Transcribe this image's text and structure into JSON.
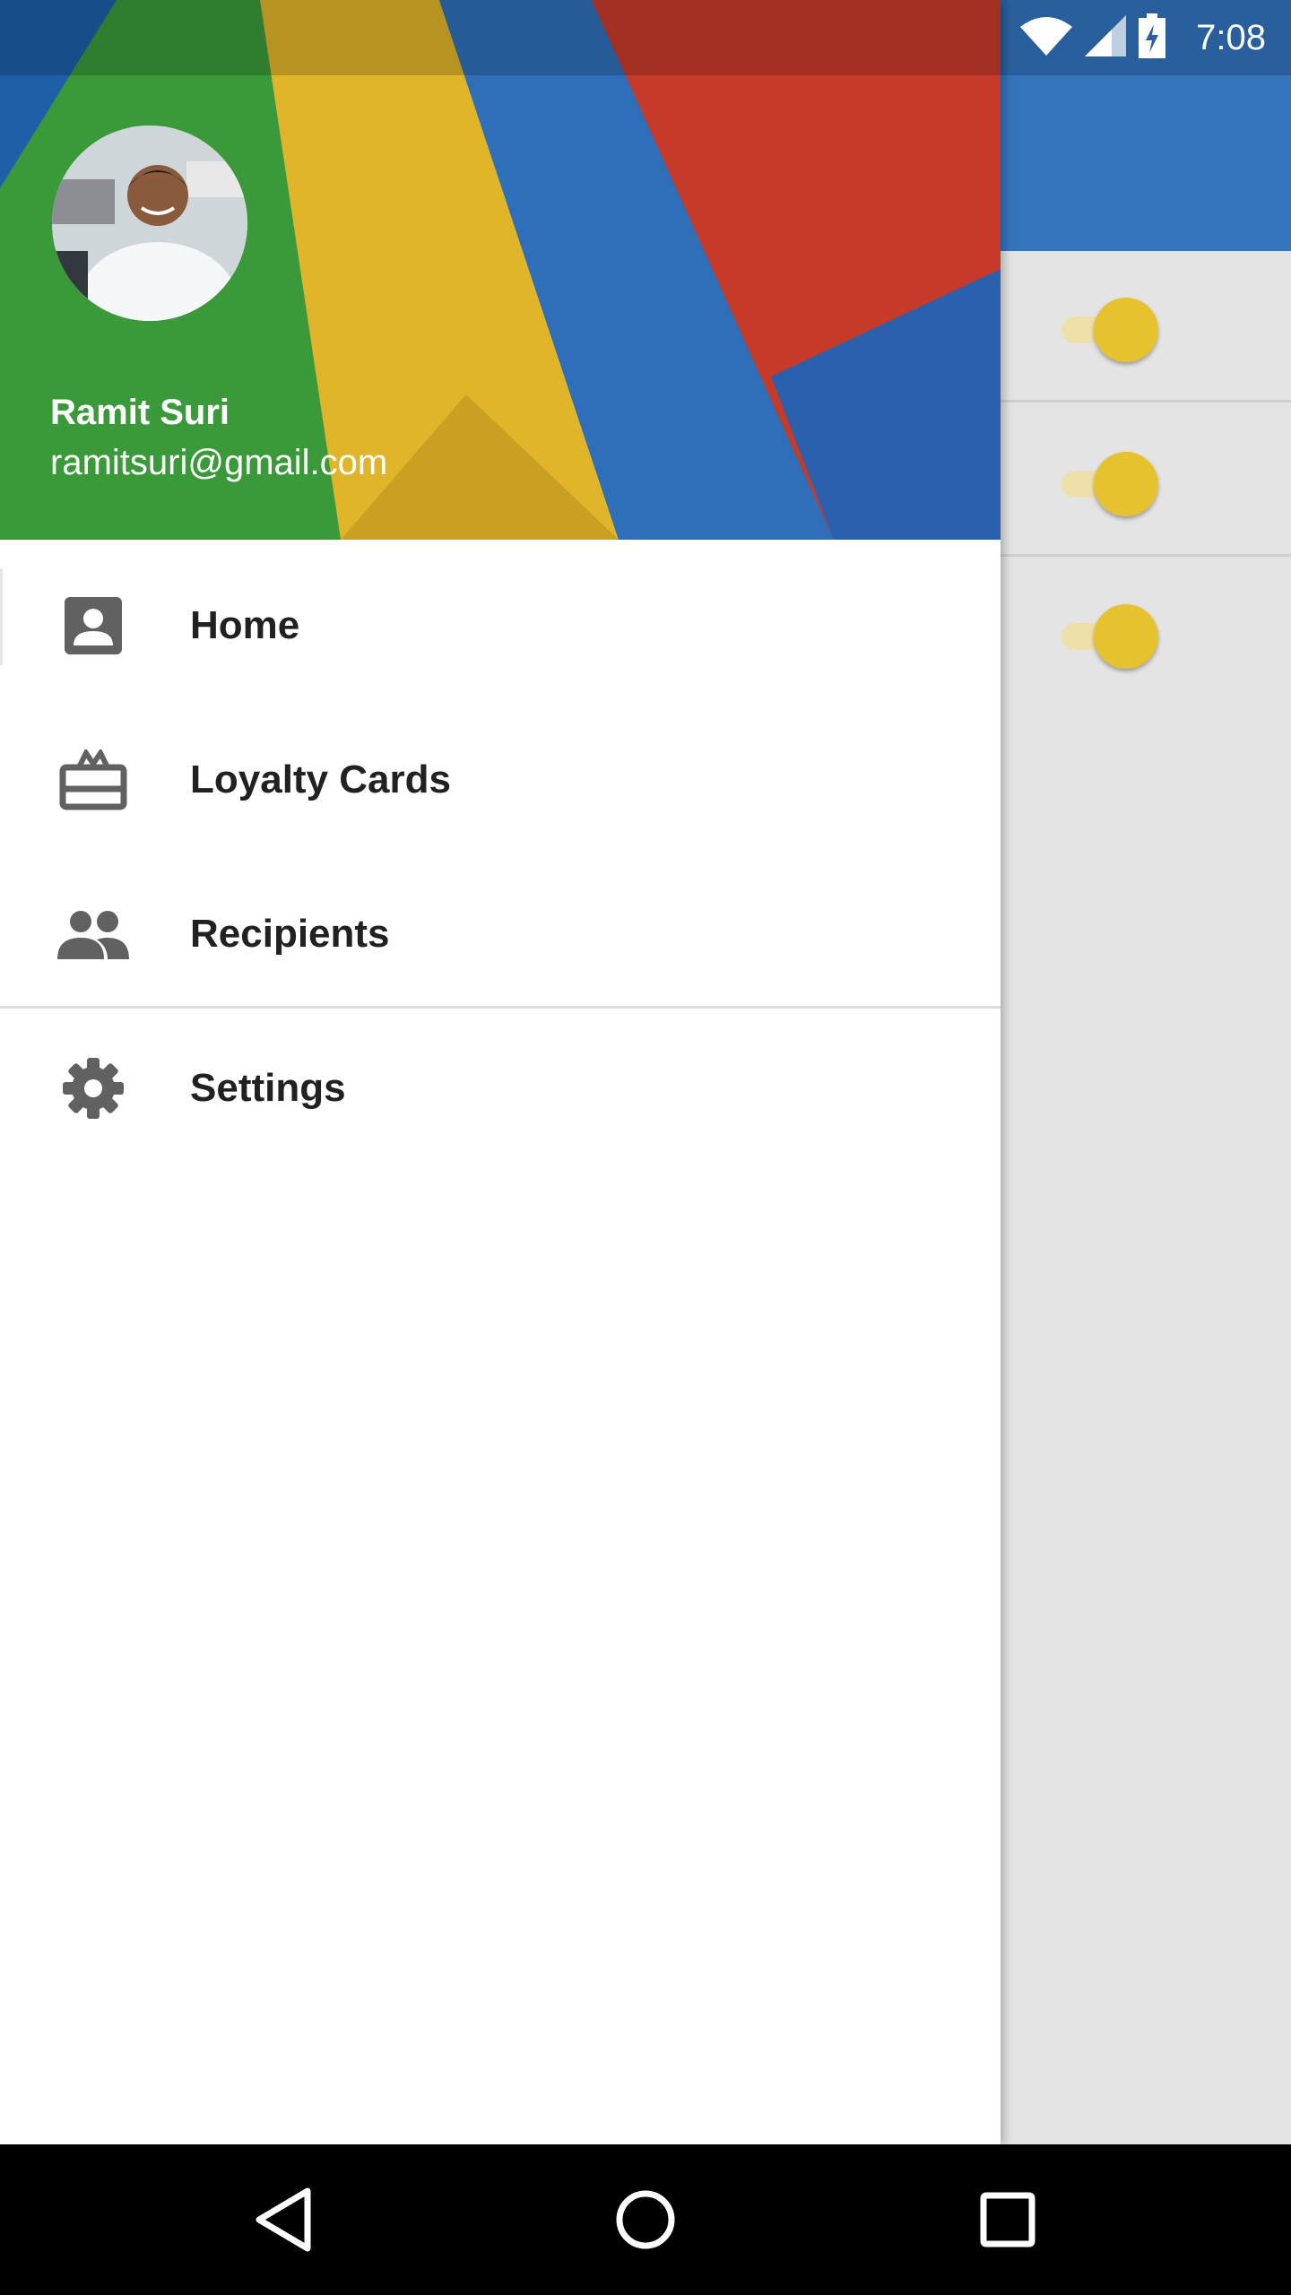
{
  "status_bar": {
    "time": "7:08"
  },
  "drawer": {
    "user_name": "Ramit Suri",
    "user_email": "ramitsuri@gmail.com",
    "items": [
      {
        "label": "Home",
        "icon": "account-box-icon"
      },
      {
        "label": "Loyalty Cards",
        "icon": "card-giftcard-icon"
      },
      {
        "label": "Recipients",
        "icon": "people-icon"
      },
      {
        "label": "Settings",
        "icon": "gear-icon"
      }
    ]
  },
  "background_toggles": [
    true,
    true,
    true
  ],
  "colors": {
    "app_bar": "#3374bd",
    "accent": "#e6c22e",
    "drawer_bg": "#ffffff",
    "text": "#212121",
    "icon": "#616161"
  }
}
